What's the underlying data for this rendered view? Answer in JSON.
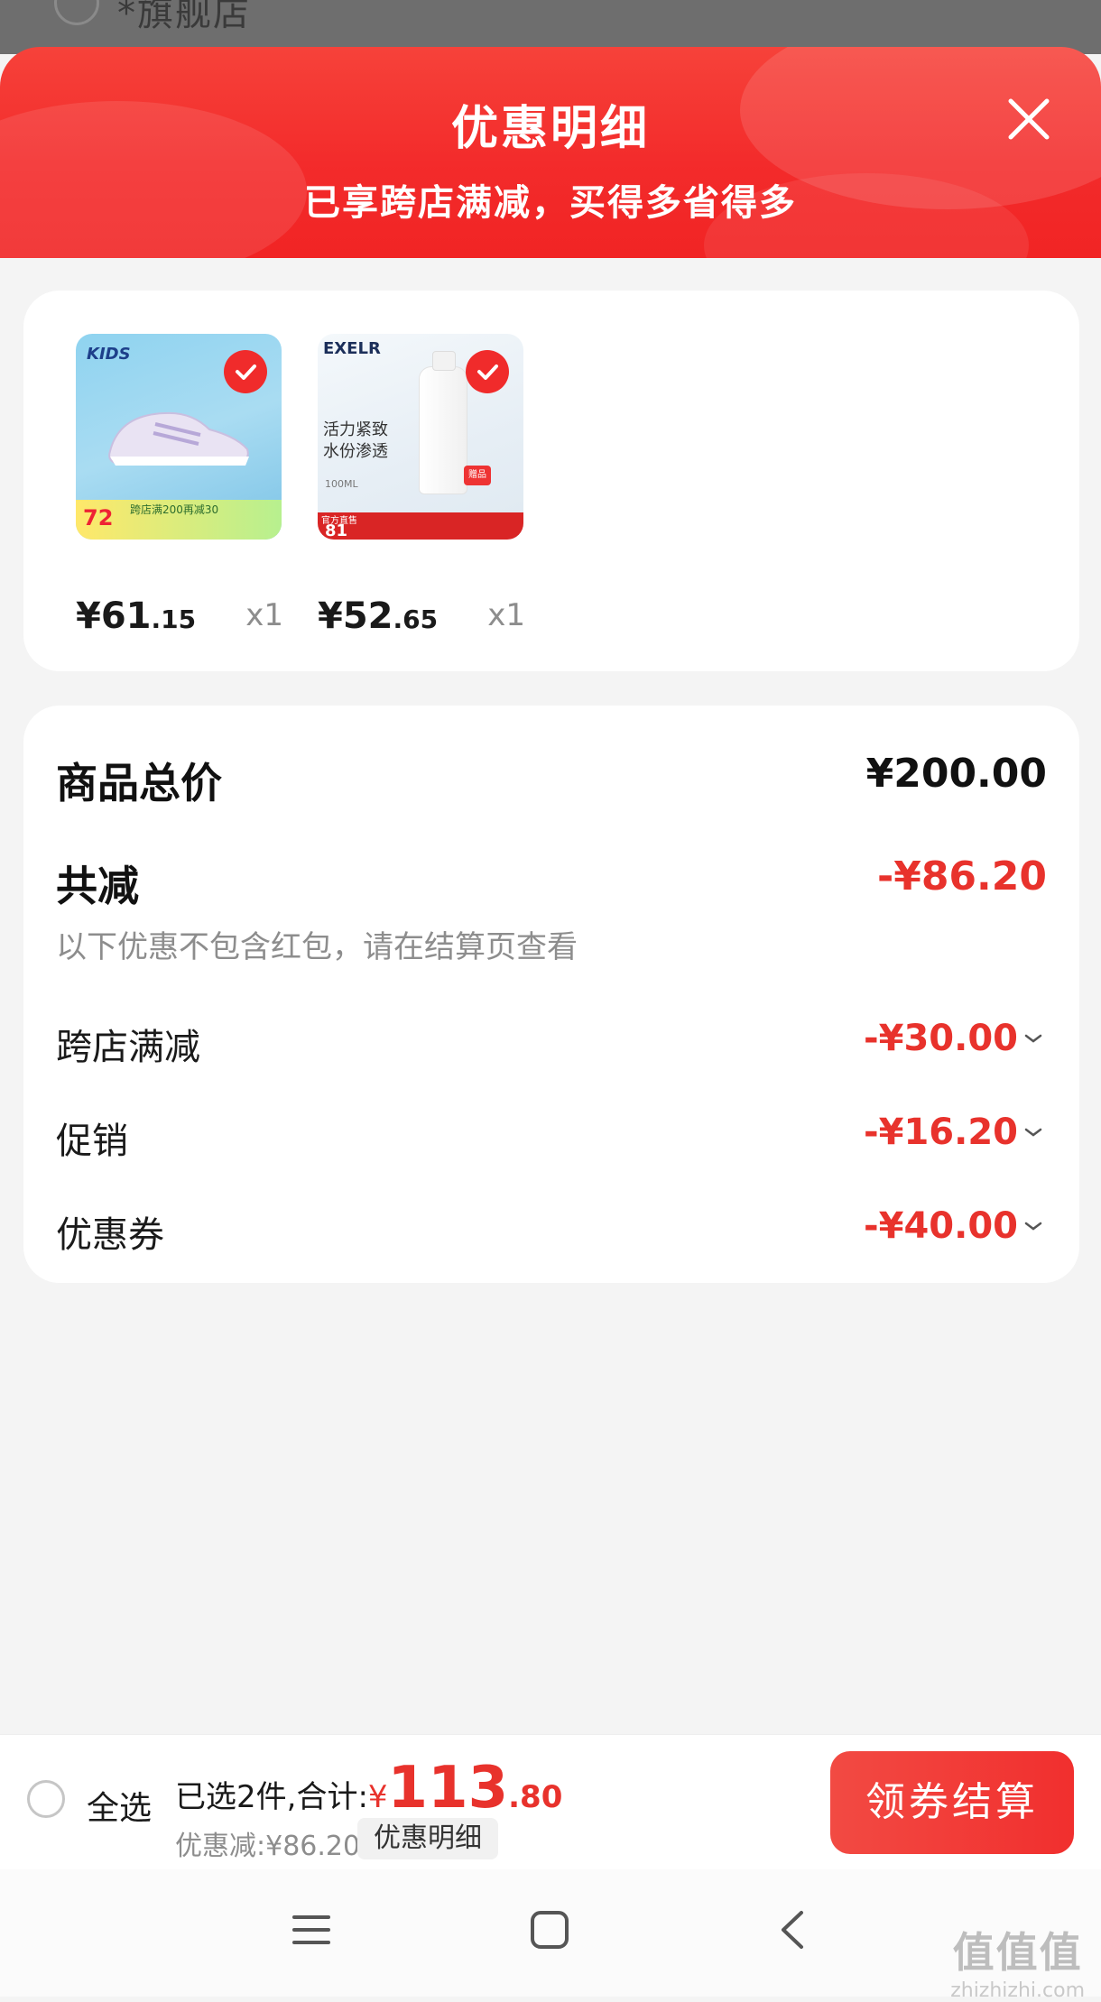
{
  "background_store": {
    "partial_name": "*旗舰店"
  },
  "sheet": {
    "title": "优惠明细",
    "subtitle": "已享跨店满减，买得多省得多"
  },
  "products": [
    {
      "name": "KIDS 童鞋",
      "thumb_brand": "KIDS",
      "thumb_banner": "跨店满200再减30",
      "thumb_price": "72",
      "price_int": "¥61",
      "price_dec": ".15",
      "qty": "x1",
      "selected": true
    },
    {
      "name": "EXELR 活力紧致水份渗透",
      "thumb_brand": "EXELR",
      "thumb_line1": "活力紧致",
      "thumb_line2": "水份渗透",
      "thumb_volume": "100ML",
      "thumb_badge": "赠品",
      "thumb_official": "官方直售",
      "thumb_price": "81",
      "price_int": "¥52",
      "price_dec": ".65",
      "qty": "x1",
      "selected": true
    }
  ],
  "summary": {
    "total_label": "商品总价",
    "total_value": "¥200.00",
    "reduce_label": "共减",
    "reduce_value": "-¥86.20",
    "note": "以下优惠不包含红包，请在结算页查看",
    "items": [
      {
        "label": "跨店满减",
        "value": "-¥30.00"
      },
      {
        "label": "促销",
        "value": "-¥16.20"
      },
      {
        "label": "优惠券",
        "value": "-¥40.00"
      }
    ]
  },
  "bottom_bar": {
    "select_all": "全选",
    "selected_text": "已选2件,合计:",
    "currency": "¥",
    "total_int": "113",
    "total_dec": ".80",
    "discount_text": "优惠减:¥86.20",
    "detail_button": "优惠明细",
    "checkout_button": "领券结算"
  },
  "watermark": {
    "big": "值值值",
    "small": "zhizhizhi.com"
  },
  "colors": {
    "accent": "#f12f2e",
    "price_red": "#e8322c"
  },
  "icons": {
    "close": "close-icon",
    "check": "check-icon",
    "chevron": "chevron-down-icon",
    "menu": "menu-icon",
    "home": "home-icon",
    "back": "back-icon"
  }
}
